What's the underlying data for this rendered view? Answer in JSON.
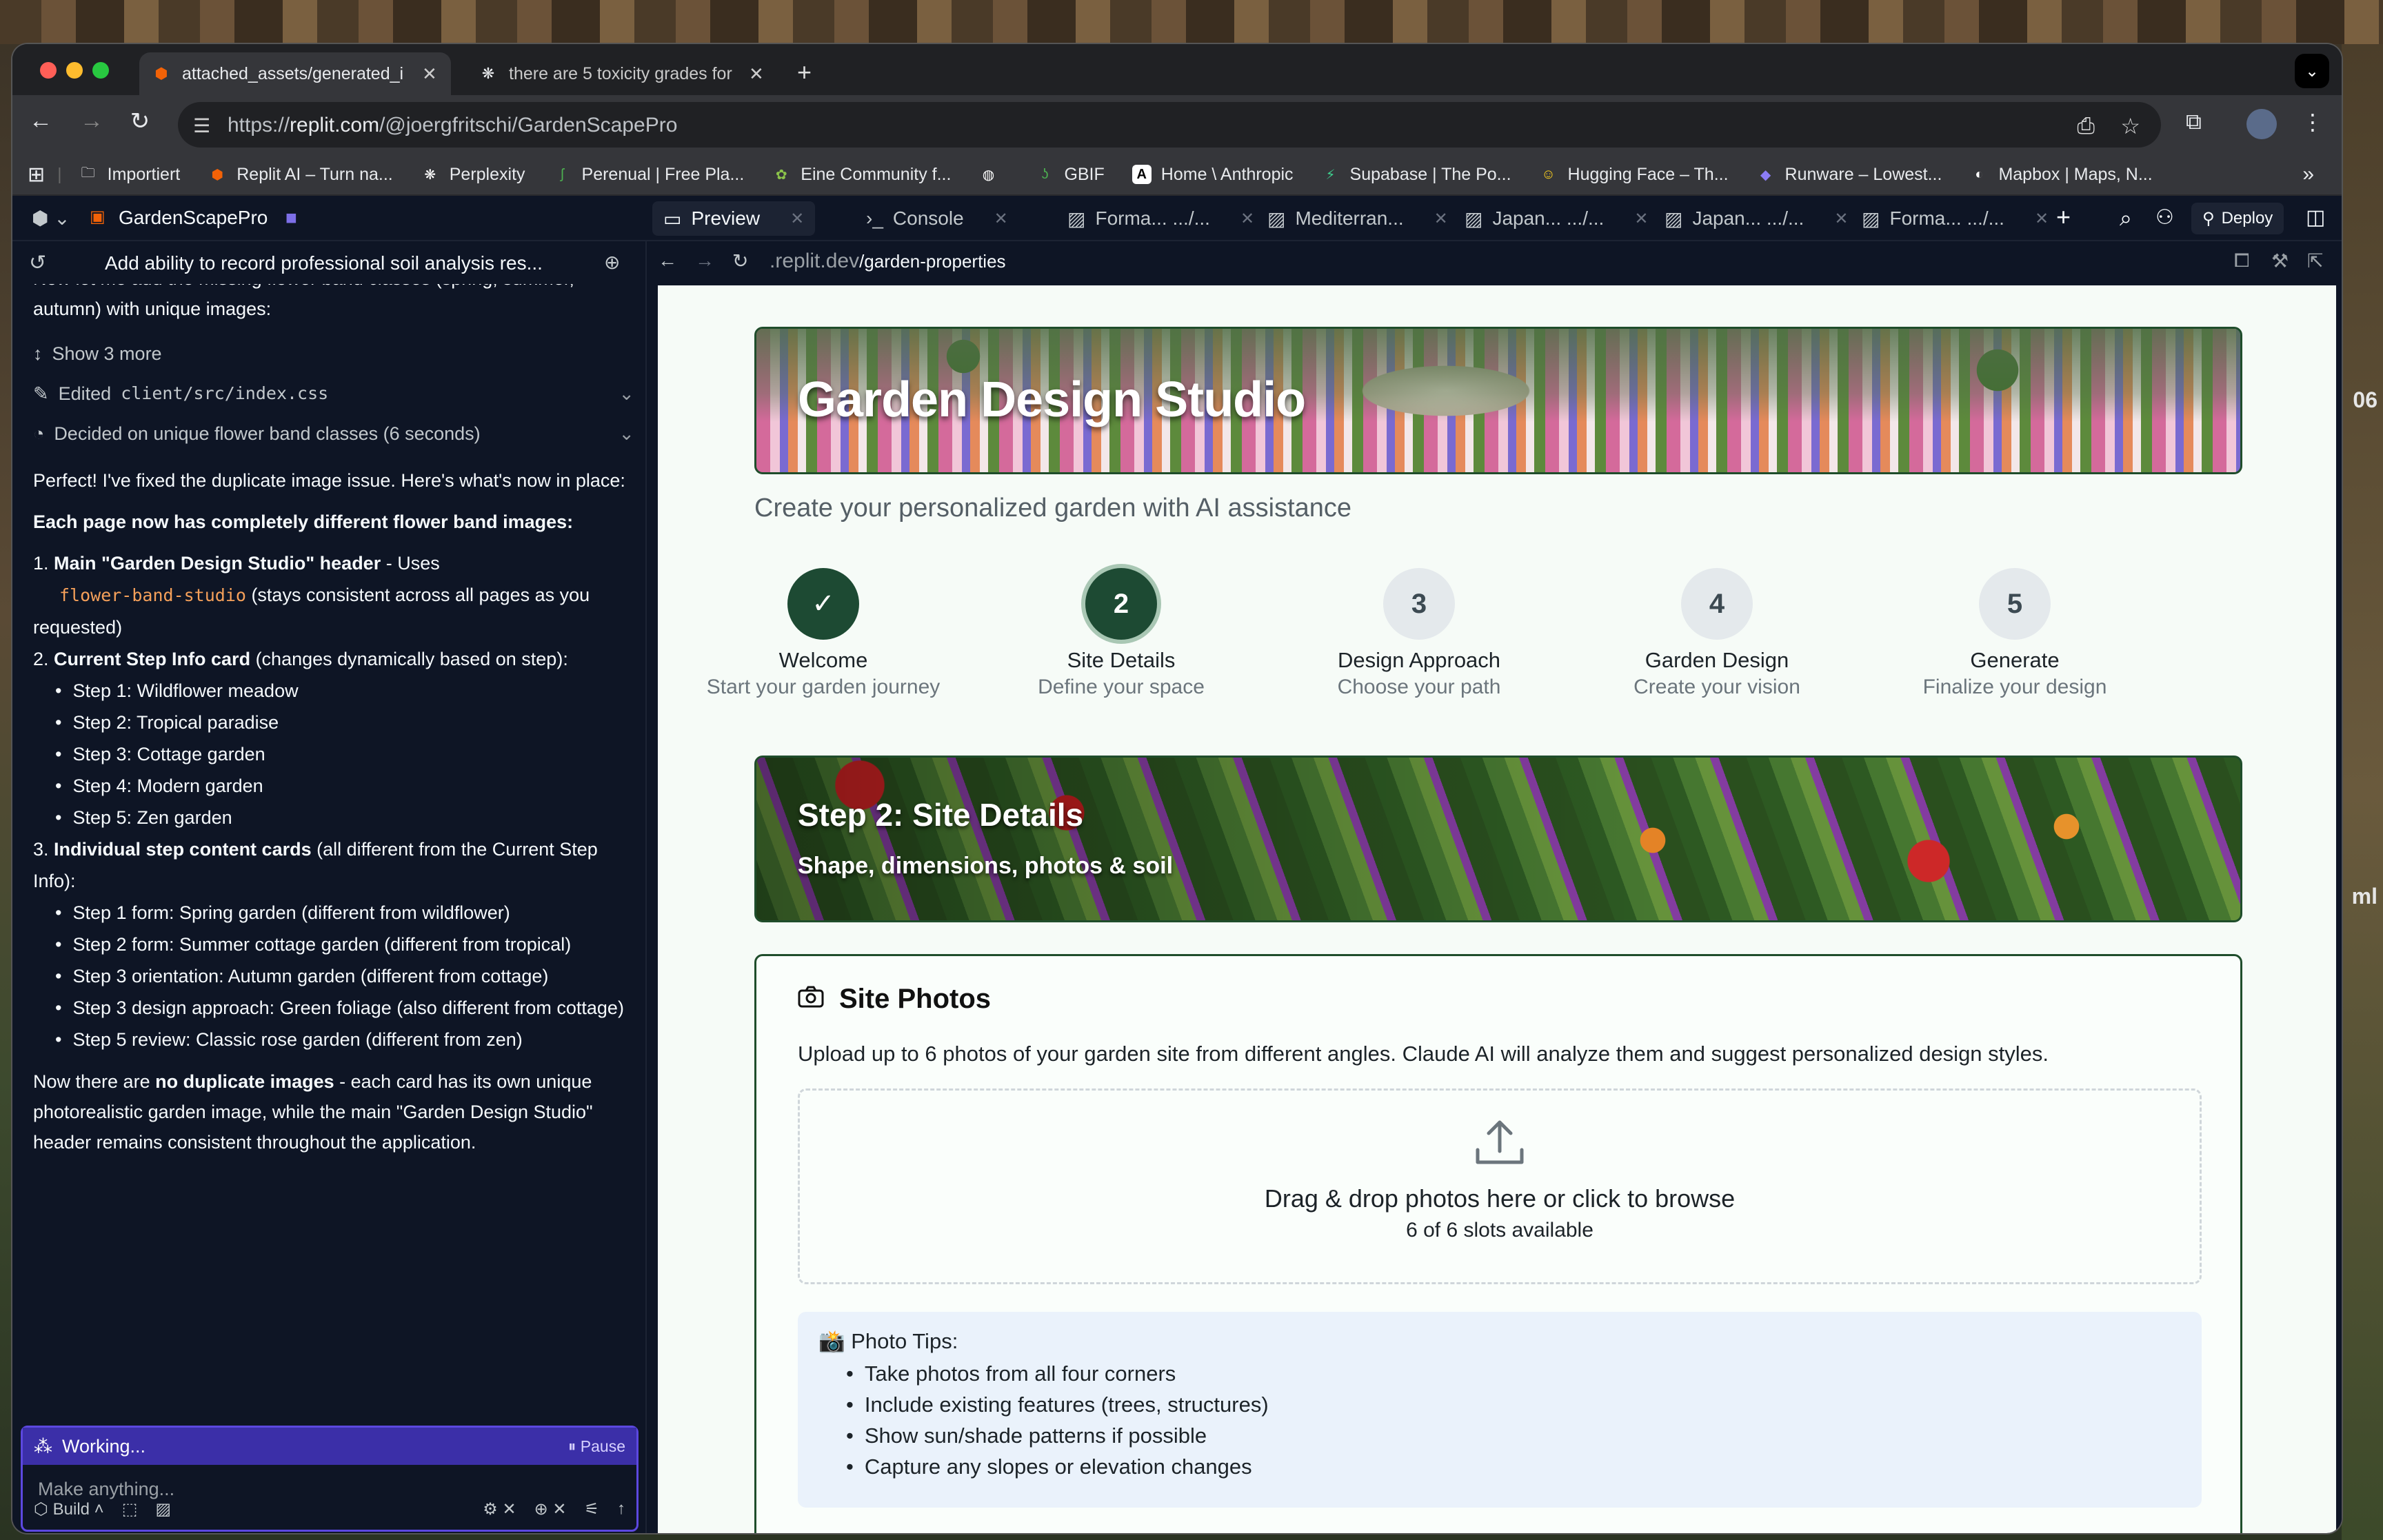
{
  "browser": {
    "tabs": [
      {
        "title": "attached_assets/generated_i",
        "active": true
      },
      {
        "title": "there are 5 toxicity grades for",
        "active": false
      }
    ],
    "url_prefix": "https://",
    "url_host": "replit.com",
    "url_path": "/@joergfritschi/GardenScapePro",
    "bookmarks": [
      {
        "label": "Importiert",
        "icon": "folder-icon"
      },
      {
        "label": "Replit AI – Turn na...",
        "icon": "replit-icon"
      },
      {
        "label": "Perplexity",
        "icon": "perplexity-icon"
      },
      {
        "label": "Perenual | Free Pla...",
        "icon": "leaf-icon"
      },
      {
        "label": "Eine Community f...",
        "icon": "plant-icon"
      },
      {
        "label": "",
        "icon": "globe-icon"
      },
      {
        "label": "GBIF",
        "icon": "gbif-icon"
      },
      {
        "label": "Home \\ Anthropic",
        "icon": "anthropic-icon"
      },
      {
        "label": "Supabase | The Po...",
        "icon": "supabase-icon"
      },
      {
        "label": "Hugging Face – Th...",
        "icon": "huggingface-icon"
      },
      {
        "label": "Runware – Lowest...",
        "icon": "runware-icon"
      },
      {
        "label": "Mapbox | Maps, N...",
        "icon": "mapbox-icon"
      }
    ]
  },
  "replit": {
    "project_name": "GardenScapePro",
    "tabs": [
      {
        "label": "Preview",
        "icon": "monitor-icon",
        "active": true
      },
      {
        "label": "Console",
        "icon": "terminal-icon",
        "active": false
      },
      {
        "label": "Forma...  .../...",
        "icon": "image-icon",
        "active": false
      },
      {
        "label": "Mediterran...",
        "icon": "image-icon",
        "active": false
      },
      {
        "label": "Japan...  .../...",
        "icon": "image-icon",
        "active": false
      },
      {
        "label": "Japan...  .../...",
        "icon": "image-icon",
        "active": false
      },
      {
        "label": "Forma...  .../...",
        "icon": "image-icon",
        "active": false
      }
    ],
    "deploy_label": "Deploy",
    "preview_url_host": ".replit.dev",
    "preview_url_path": "/garden-properties"
  },
  "chat": {
    "task_title": "Add ability to record professional soil analysis res...",
    "cut_text": "Now let me add the missing flower band classes (spring, summer, autumn) with unique images:",
    "show_more": "Show 3 more",
    "edited_label": "Edited",
    "edited_file": "client/src/index.css",
    "decided": "Decided on unique flower band classes (6 seconds)",
    "intro": "Perfect! I've fixed the duplicate image issue. Here's what's now in place:",
    "heading": "Each page now has completely different flower band images:",
    "item1_bold": "Main \"Garden Design Studio\" header",
    "item1_rest": " - Uses",
    "item1_code": "flower-band-studio",
    "item1_tail": " (stays consistent across all pages as you requested)",
    "item2_bold": "Current Step Info card",
    "item2_rest": " (changes dynamically based on step):",
    "item2_sub": [
      "Step 1: Wildflower meadow",
      "Step 2: Tropical paradise",
      "Step 3: Cottage garden",
      "Step 4: Modern garden",
      "Step 5: Zen garden"
    ],
    "item3_bold": "Individual step content cards",
    "item3_rest": " (all different from the Current Step Info):",
    "item3_sub": [
      "Step 1 form: Spring garden (different from wildflower)",
      "Step 2 form: Summer cottage garden (different from tropical)",
      "Step 3 orientation: Autumn garden (different from cottage)",
      "Step 3 design approach: Green foliage (also different from cottage)",
      "Step 5 review: Classic rose garden (different from zen)"
    ],
    "outro_pre": "Now there are ",
    "outro_bold": "no duplicate images",
    "outro_post": " - each card has its own unique photorealistic garden image, while the main \"Garden Design Studio\" header remains consistent throughout the application.",
    "working_label": "Working...",
    "pause_label": "Pause",
    "input_placeholder": "Make anything...",
    "build_label": "Build"
  },
  "app": {
    "hero_title": "Garden Design Studio",
    "subtitle": "Create your personalized garden with AI assistance",
    "steps": [
      {
        "number": "✓",
        "label": "Welcome",
        "desc": "Start your garden journey",
        "state": "done"
      },
      {
        "number": "2",
        "label": "Site Details",
        "desc": "Define your space",
        "state": "current"
      },
      {
        "number": "3",
        "label": "Design Approach",
        "desc": "Choose your path",
        "state": "todo"
      },
      {
        "number": "4",
        "label": "Garden Design",
        "desc": "Create your vision",
        "state": "todo"
      },
      {
        "number": "5",
        "label": "Generate",
        "desc": "Finalize your design",
        "state": "todo"
      }
    ],
    "step_banner_title": "Step 2: Site Details",
    "step_banner_sub": "Shape, dimensions, photos & soil",
    "card_title": "Site Photos",
    "card_desc": "Upload up to 6 photos of your garden site from different angles. Claude AI will analyze them and suggest personalized design styles.",
    "dropzone_main": "Drag & drop photos here or click to browse",
    "dropzone_sub": "6 of 6 slots available",
    "tips_title": "📸 Photo Tips:",
    "tips": [
      "Take photos from all four corners",
      "Include existing features (trees, structures)",
      "Show sun/shade patterns if possible",
      "Capture any slopes or elevation changes"
    ]
  },
  "background_fragments": [
    "06",
    "ml"
  ],
  "colors": {
    "accent_green": "#1d4a33",
    "replit_bg": "#0e1525",
    "working_purple": "#3b2fa8"
  }
}
